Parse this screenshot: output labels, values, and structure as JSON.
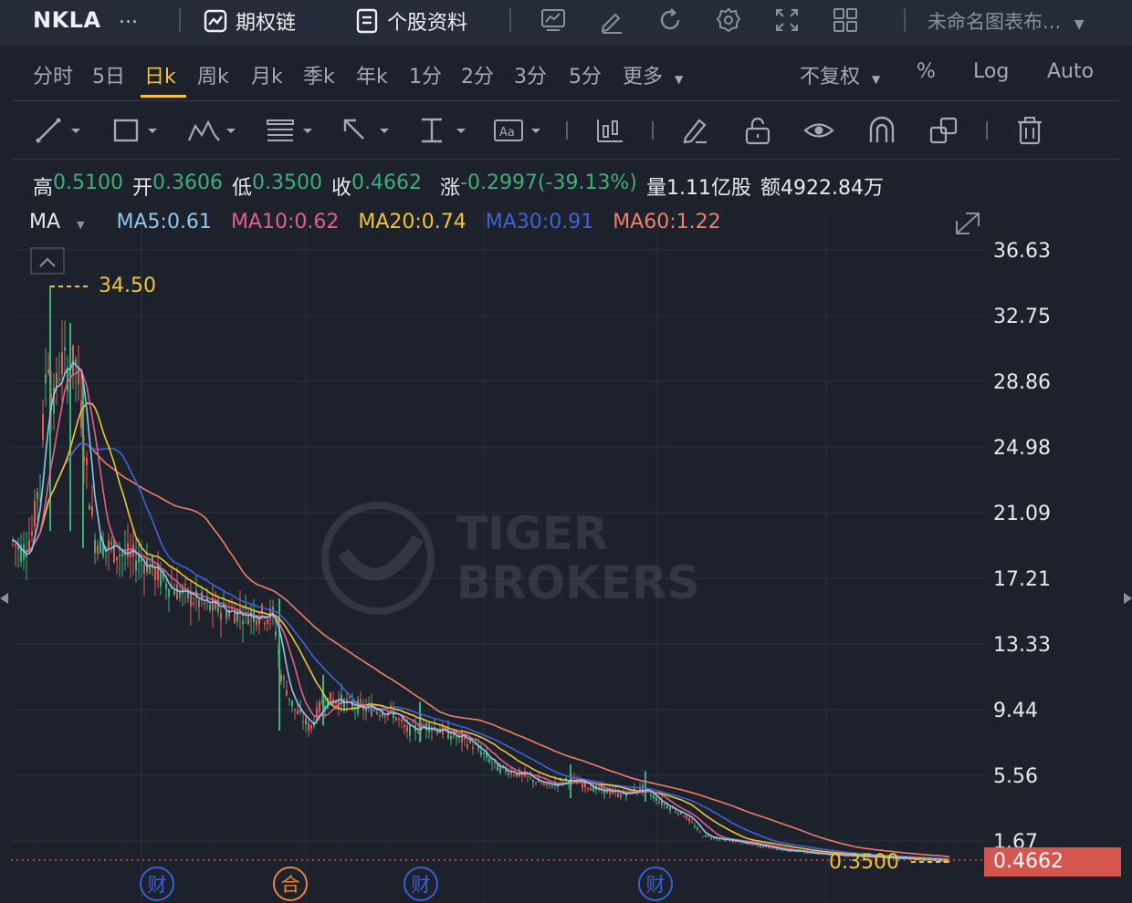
{
  "header": {
    "ticker": "NKLA",
    "ticker_more": "...",
    "options_chain": "期权链",
    "stock_info": "个股资料",
    "layout_name": "未命名图表布..."
  },
  "periods": [
    "分时",
    "5日",
    "日k",
    "周k",
    "月k",
    "季k",
    "年k",
    "1分",
    "2分",
    "3分",
    "5分",
    "更多"
  ],
  "active_period": "日k",
  "right_options": {
    "adjust": "不复权",
    "percent": "%",
    "log": "Log",
    "auto": "Auto"
  },
  "quote": {
    "high_label": "高",
    "high": "0.5100",
    "open_label": "开",
    "open": "0.3606",
    "low_label": "低",
    "low": "0.3500",
    "close_label": "收",
    "close": "0.4662",
    "change_label": "涨",
    "change": "-0.2997(-39.13%)",
    "volume_label": "量",
    "volume": "1.11亿股",
    "amount_label": "额",
    "amount": "4922.84万"
  },
  "indicators": {
    "ma_label": "MA",
    "ma5": "MA5:0.61",
    "ma10": "MA10:0.62",
    "ma20": "MA20:0.74",
    "ma30": "MA30:0.91",
    "ma60": "MA60:1.22"
  },
  "colors": {
    "ma5": "#8fc6ee",
    "ma10": "#e45f88",
    "ma20": "#f0c531",
    "ma30": "#3e63d6",
    "ma60": "#ef7f68",
    "up": "#e05a56",
    "down": "#3fae78",
    "accent": "#f3c342"
  },
  "chart": {
    "y_ticks": [
      "36.63",
      "32.75",
      "28.86",
      "24.98",
      "21.09",
      "17.21",
      "13.33",
      "9.44",
      "5.56",
      "1.67"
    ],
    "max_marker": "34.50",
    "min_marker": "0.3500",
    "last_price": "0.4662",
    "event_badges": [
      "财",
      "合",
      "财",
      "财"
    ],
    "watermark": [
      "TIGER",
      "BROKERS"
    ]
  },
  "chart_data": {
    "type": "candlestick",
    "y_axis": {
      "min": 0.35,
      "max": 36.63
    },
    "series": [
      {
        "name": "MA5",
        "value": 0.61
      },
      {
        "name": "MA10",
        "value": 0.62
      },
      {
        "name": "MA20",
        "value": 0.74
      },
      {
        "name": "MA30",
        "value": 0.91
      },
      {
        "name": "MA60",
        "value": 1.22
      }
    ],
    "period_high": 34.5,
    "period_low": 0.35,
    "last": 0.4662
  }
}
